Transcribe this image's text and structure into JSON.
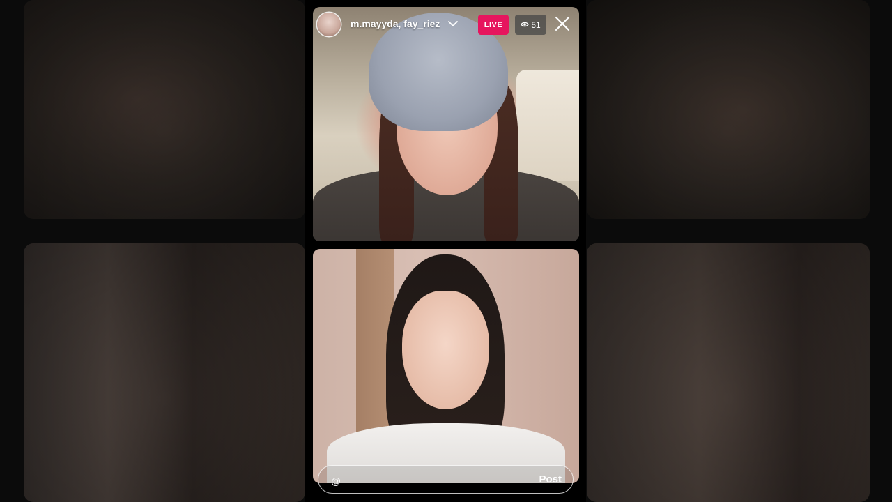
{
  "stream": {
    "usernames": "m.mayyda, fay_riez",
    "live_label": "LIVE",
    "viewer_count": "51"
  },
  "comment": {
    "placeholder": "@",
    "post_label": "Post"
  },
  "icons": {
    "avatar": "profile-avatar",
    "dropdown": "chevron-down-icon",
    "viewers": "eye-icon",
    "close": "close-icon"
  },
  "colors": {
    "live_badge": "#e6155e",
    "viewer_badge": "#464646"
  }
}
